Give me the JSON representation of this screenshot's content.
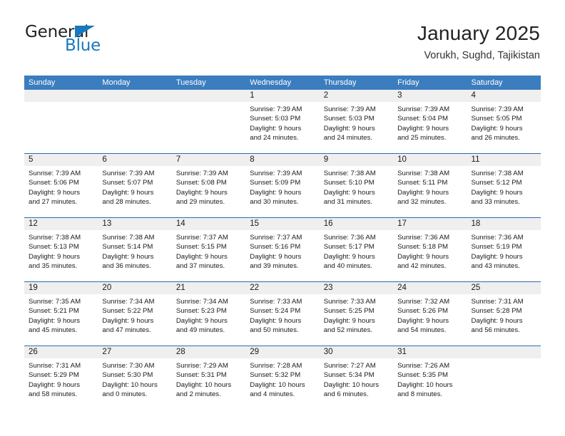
{
  "brand": {
    "word_one": "General",
    "word_two": "Blue",
    "triangle_icon": "blue-triangle-icon",
    "accent_color": "#1878be"
  },
  "header": {
    "title": "January 2025",
    "subtitle": "Vorukh, Sughd, Tajikistan"
  },
  "colors": {
    "header_blue": "#3b7dbf",
    "row_separator_blue": "#2a6cb0",
    "number_band_gray": "#efefef",
    "text": "#1a1a1a"
  },
  "calendar": {
    "weekday_headers": [
      "Sunday",
      "Monday",
      "Tuesday",
      "Wednesday",
      "Thursday",
      "Friday",
      "Saturday"
    ],
    "weeks": [
      [
        {
          "day": "",
          "lines": [
            "",
            "",
            "",
            ""
          ]
        },
        {
          "day": "",
          "lines": [
            "",
            "",
            "",
            ""
          ]
        },
        {
          "day": "",
          "lines": [
            "",
            "",
            "",
            ""
          ]
        },
        {
          "day": "1",
          "lines": [
            "Sunrise: 7:39 AM",
            "Sunset: 5:03 PM",
            "Daylight: 9 hours",
            "and 24 minutes."
          ]
        },
        {
          "day": "2",
          "lines": [
            "Sunrise: 7:39 AM",
            "Sunset: 5:03 PM",
            "Daylight: 9 hours",
            "and 24 minutes."
          ]
        },
        {
          "day": "3",
          "lines": [
            "Sunrise: 7:39 AM",
            "Sunset: 5:04 PM",
            "Daylight: 9 hours",
            "and 25 minutes."
          ]
        },
        {
          "day": "4",
          "lines": [
            "Sunrise: 7:39 AM",
            "Sunset: 5:05 PM",
            "Daylight: 9 hours",
            "and 26 minutes."
          ]
        }
      ],
      [
        {
          "day": "5",
          "lines": [
            "Sunrise: 7:39 AM",
            "Sunset: 5:06 PM",
            "Daylight: 9 hours",
            "and 27 minutes."
          ]
        },
        {
          "day": "6",
          "lines": [
            "Sunrise: 7:39 AM",
            "Sunset: 5:07 PM",
            "Daylight: 9 hours",
            "and 28 minutes."
          ]
        },
        {
          "day": "7",
          "lines": [
            "Sunrise: 7:39 AM",
            "Sunset: 5:08 PM",
            "Daylight: 9 hours",
            "and 29 minutes."
          ]
        },
        {
          "day": "8",
          "lines": [
            "Sunrise: 7:39 AM",
            "Sunset: 5:09 PM",
            "Daylight: 9 hours",
            "and 30 minutes."
          ]
        },
        {
          "day": "9",
          "lines": [
            "Sunrise: 7:38 AM",
            "Sunset: 5:10 PM",
            "Daylight: 9 hours",
            "and 31 minutes."
          ]
        },
        {
          "day": "10",
          "lines": [
            "Sunrise: 7:38 AM",
            "Sunset: 5:11 PM",
            "Daylight: 9 hours",
            "and 32 minutes."
          ]
        },
        {
          "day": "11",
          "lines": [
            "Sunrise: 7:38 AM",
            "Sunset: 5:12 PM",
            "Daylight: 9 hours",
            "and 33 minutes."
          ]
        }
      ],
      [
        {
          "day": "12",
          "lines": [
            "Sunrise: 7:38 AM",
            "Sunset: 5:13 PM",
            "Daylight: 9 hours",
            "and 35 minutes."
          ]
        },
        {
          "day": "13",
          "lines": [
            "Sunrise: 7:38 AM",
            "Sunset: 5:14 PM",
            "Daylight: 9 hours",
            "and 36 minutes."
          ]
        },
        {
          "day": "14",
          "lines": [
            "Sunrise: 7:37 AM",
            "Sunset: 5:15 PM",
            "Daylight: 9 hours",
            "and 37 minutes."
          ]
        },
        {
          "day": "15",
          "lines": [
            "Sunrise: 7:37 AM",
            "Sunset: 5:16 PM",
            "Daylight: 9 hours",
            "and 39 minutes."
          ]
        },
        {
          "day": "16",
          "lines": [
            "Sunrise: 7:36 AM",
            "Sunset: 5:17 PM",
            "Daylight: 9 hours",
            "and 40 minutes."
          ]
        },
        {
          "day": "17",
          "lines": [
            "Sunrise: 7:36 AM",
            "Sunset: 5:18 PM",
            "Daylight: 9 hours",
            "and 42 minutes."
          ]
        },
        {
          "day": "18",
          "lines": [
            "Sunrise: 7:36 AM",
            "Sunset: 5:19 PM",
            "Daylight: 9 hours",
            "and 43 minutes."
          ]
        }
      ],
      [
        {
          "day": "19",
          "lines": [
            "Sunrise: 7:35 AM",
            "Sunset: 5:21 PM",
            "Daylight: 9 hours",
            "and 45 minutes."
          ]
        },
        {
          "day": "20",
          "lines": [
            "Sunrise: 7:34 AM",
            "Sunset: 5:22 PM",
            "Daylight: 9 hours",
            "and 47 minutes."
          ]
        },
        {
          "day": "21",
          "lines": [
            "Sunrise: 7:34 AM",
            "Sunset: 5:23 PM",
            "Daylight: 9 hours",
            "and 49 minutes."
          ]
        },
        {
          "day": "22",
          "lines": [
            "Sunrise: 7:33 AM",
            "Sunset: 5:24 PM",
            "Daylight: 9 hours",
            "and 50 minutes."
          ]
        },
        {
          "day": "23",
          "lines": [
            "Sunrise: 7:33 AM",
            "Sunset: 5:25 PM",
            "Daylight: 9 hours",
            "and 52 minutes."
          ]
        },
        {
          "day": "24",
          "lines": [
            "Sunrise: 7:32 AM",
            "Sunset: 5:26 PM",
            "Daylight: 9 hours",
            "and 54 minutes."
          ]
        },
        {
          "day": "25",
          "lines": [
            "Sunrise: 7:31 AM",
            "Sunset: 5:28 PM",
            "Daylight: 9 hours",
            "and 56 minutes."
          ]
        }
      ],
      [
        {
          "day": "26",
          "lines": [
            "Sunrise: 7:31 AM",
            "Sunset: 5:29 PM",
            "Daylight: 9 hours",
            "and 58 minutes."
          ]
        },
        {
          "day": "27",
          "lines": [
            "Sunrise: 7:30 AM",
            "Sunset: 5:30 PM",
            "Daylight: 10 hours",
            "and 0 minutes."
          ]
        },
        {
          "day": "28",
          "lines": [
            "Sunrise: 7:29 AM",
            "Sunset: 5:31 PM",
            "Daylight: 10 hours",
            "and 2 minutes."
          ]
        },
        {
          "day": "29",
          "lines": [
            "Sunrise: 7:28 AM",
            "Sunset: 5:32 PM",
            "Daylight: 10 hours",
            "and 4 minutes."
          ]
        },
        {
          "day": "30",
          "lines": [
            "Sunrise: 7:27 AM",
            "Sunset: 5:34 PM",
            "Daylight: 10 hours",
            "and 6 minutes."
          ]
        },
        {
          "day": "31",
          "lines": [
            "Sunrise: 7:26 AM",
            "Sunset: 5:35 PM",
            "Daylight: 10 hours",
            "and 8 minutes."
          ]
        },
        {
          "day": "",
          "lines": [
            "",
            "",
            "",
            ""
          ]
        }
      ]
    ]
  }
}
